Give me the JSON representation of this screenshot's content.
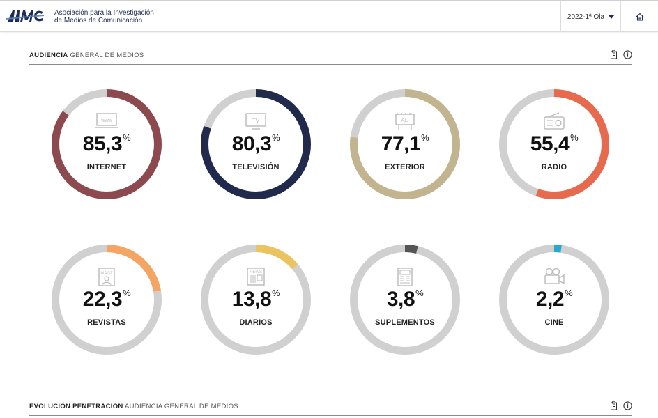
{
  "header": {
    "org_line1": "Asociación para la Investigación",
    "org_line2": "de Medios de Comunicación",
    "wave": "2022-1ª Ola"
  },
  "section1": {
    "title_bold": "AUDIENCIA",
    "title_light": "GENERAL DE MEDIOS"
  },
  "section2": {
    "title_bold": "EVOLUCIÓN PENETRACIÓN",
    "title_light": "AUDIENCIA GENERAL DE MEDIOS"
  },
  "track_color": "#d0d0d0",
  "media": [
    {
      "label": "INTERNET",
      "value": "85,3",
      "percent": 85.3,
      "color": "#8c4a4f",
      "icon": "www-icon"
    },
    {
      "label": "TELEVISIÓN",
      "value": "80,3",
      "percent": 80.3,
      "color": "#1f2a4c",
      "icon": "tv-icon"
    },
    {
      "label": "EXTERIOR",
      "value": "77,1",
      "percent": 77.1,
      "color": "#c2b48e",
      "icon": "billboard-icon"
    },
    {
      "label": "RADIO",
      "value": "55,4",
      "percent": 55.4,
      "color": "#e76a4e",
      "icon": "radio-icon"
    },
    {
      "label": "REVISTAS",
      "value": "22,3",
      "percent": 22.3,
      "color": "#f5a563",
      "icon": "magazine-icon"
    },
    {
      "label": "DIARIOS",
      "value": "13,8",
      "percent": 13.8,
      "color": "#ebc460",
      "icon": "newspaper-icon"
    },
    {
      "label": "SUPLEMENTOS",
      "value": "3,8",
      "percent": 3.8,
      "color": "#555555",
      "icon": "supplement-icon"
    },
    {
      "label": "CINE",
      "value": "2,2",
      "percent": 2.2,
      "color": "#2aa7cf",
      "icon": "cinema-camera-icon"
    }
  ],
  "percent_symbol": "%"
}
